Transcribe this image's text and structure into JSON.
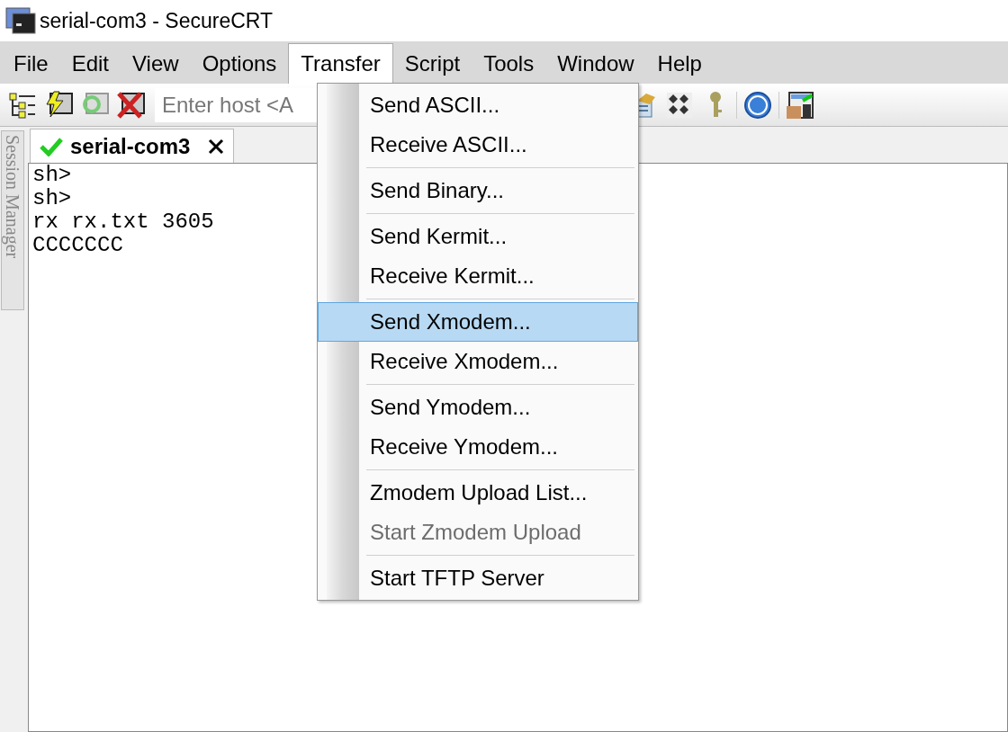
{
  "window": {
    "title": "serial-com3 - SecureCRT"
  },
  "menu_bar": [
    {
      "label": "File",
      "selected": false
    },
    {
      "label": "Edit",
      "selected": false
    },
    {
      "label": "View",
      "selected": false
    },
    {
      "label": "Options",
      "selected": false
    },
    {
      "label": "Transfer",
      "selected": true
    },
    {
      "label": "Script",
      "selected": false
    },
    {
      "label": "Tools",
      "selected": false
    },
    {
      "label": "Window",
      "selected": false
    },
    {
      "label": "Help",
      "selected": false
    }
  ],
  "toolbar": {
    "host_field": {
      "placeholder": "Enter host <A"
    }
  },
  "side_panel": {
    "label": "Session Manager"
  },
  "tabs": [
    {
      "label": "serial-com3",
      "connected": true,
      "selected": true
    }
  ],
  "terminal": {
    "lines": [
      "sh>",
      "sh>",
      "rx rx.txt 3605",
      "CCCCCCC"
    ]
  },
  "transfer_menu": {
    "groups": [
      [
        {
          "label": "Send ASCII...",
          "selected": false,
          "disabled": false
        },
        {
          "label": "Receive ASCII...",
          "selected": false,
          "disabled": false
        }
      ],
      [
        {
          "label": "Send Binary...",
          "selected": false,
          "disabled": false
        }
      ],
      [
        {
          "label": "Send Kermit...",
          "selected": false,
          "disabled": false
        },
        {
          "label": "Receive Kermit...",
          "selected": false,
          "disabled": false
        }
      ],
      [
        {
          "label": "Send Xmodem...",
          "selected": true,
          "disabled": false
        },
        {
          "label": "Receive Xmodem...",
          "selected": false,
          "disabled": false
        }
      ],
      [
        {
          "label": "Send Ymodem...",
          "selected": false,
          "disabled": false
        },
        {
          "label": "Receive Ymodem...",
          "selected": false,
          "disabled": false
        }
      ],
      [
        {
          "label": "Zmodem Upload List...",
          "selected": false,
          "disabled": false
        },
        {
          "label": "Start Zmodem Upload",
          "selected": false,
          "disabled": true
        }
      ],
      [
        {
          "label": "Start TFTP Server",
          "selected": false,
          "disabled": false
        }
      ]
    ]
  }
}
